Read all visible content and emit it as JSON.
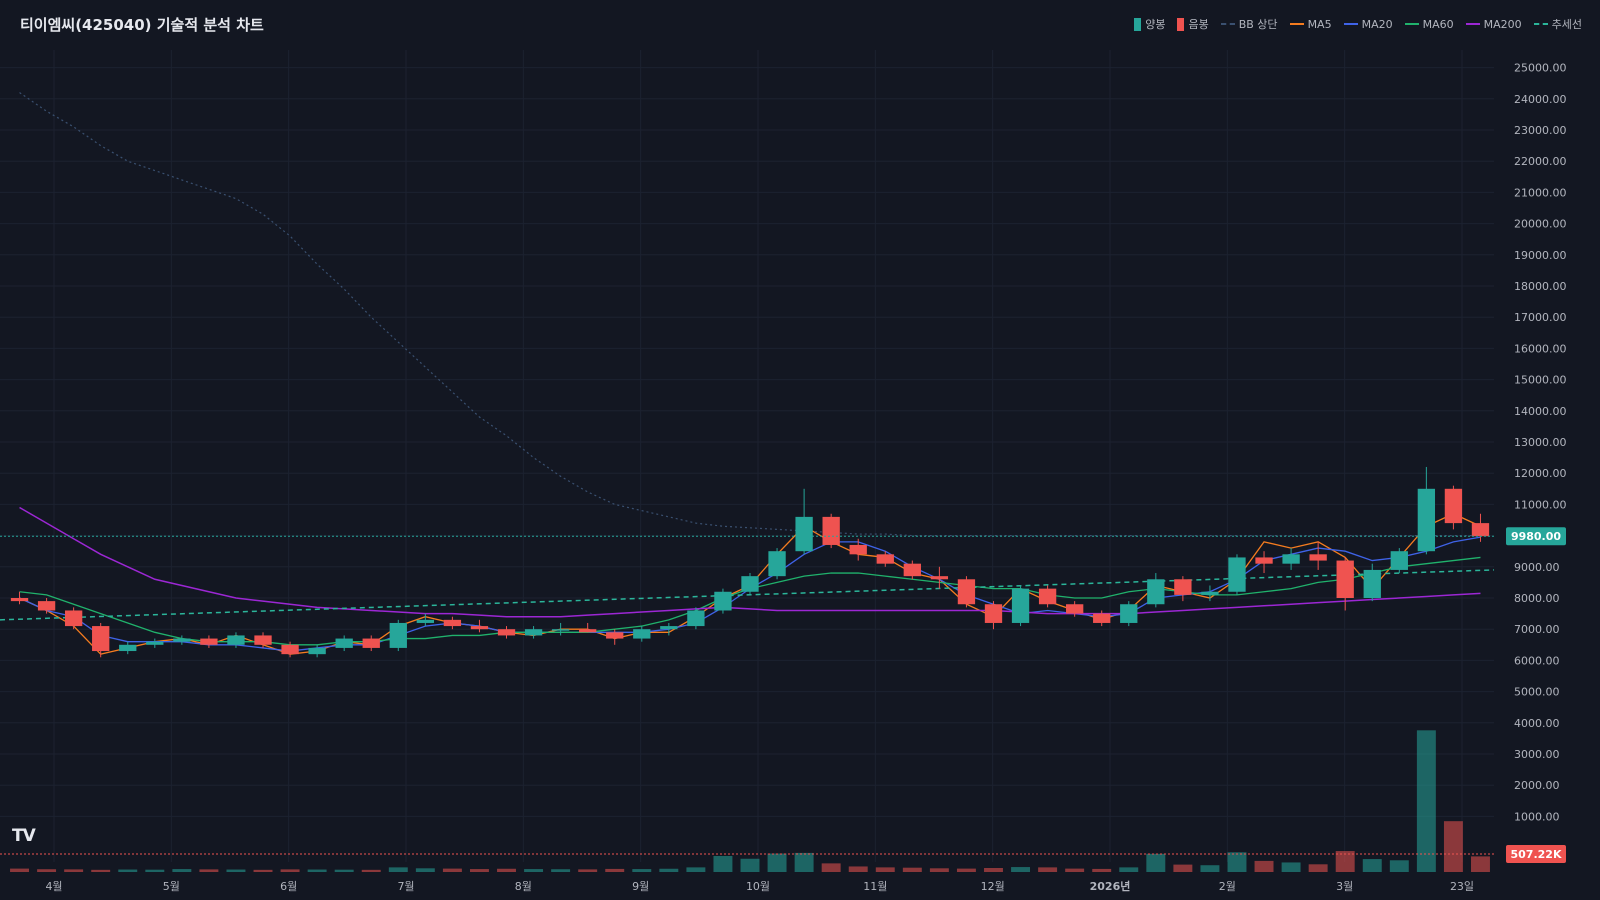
{
  "title": "티이엠씨(425040) 기술적 분석 차트",
  "logo_text": "TV",
  "colors": {
    "background": "#131722",
    "grid": "#1c2230",
    "up": "#26a69a",
    "down": "#ef5350",
    "bb_upper": "#3a5070",
    "ma5": "#f57c1f",
    "ma20": "#3f63e8",
    "ma60": "#20b26c",
    "ma200": "#9c27d4",
    "trend": "#2bb59a",
    "axis_text": "#b2b5be"
  },
  "legend": [
    {
      "label": "양봉",
      "kind": "box",
      "color": "#26a69a"
    },
    {
      "label": "음봉",
      "kind": "box",
      "color": "#ef5350"
    },
    {
      "label": "BB 상단",
      "kind": "dash",
      "color": "#3a5070"
    },
    {
      "label": "MA5",
      "kind": "line",
      "color": "#f57c1f"
    },
    {
      "label": "MA20",
      "kind": "line",
      "color": "#3f63e8"
    },
    {
      "label": "MA60",
      "kind": "line",
      "color": "#20b26c"
    },
    {
      "label": "MA200",
      "kind": "line",
      "color": "#9c27d4"
    },
    {
      "label": "추세선",
      "kind": "dash",
      "color": "#2bb59a"
    }
  ],
  "chart_data": {
    "type": "candlestick",
    "title": "티이엠씨(425040) 기술적 분석 차트",
    "y_axis": {
      "ticks": [
        "25000.00",
        "24000.00",
        "23000.00",
        "22000.00",
        "21000.00",
        "20000.00",
        "19000.00",
        "18000.00",
        "17000.00",
        "16000.00",
        "15000.00",
        "14000.00",
        "13000.00",
        "12000.00",
        "11000.00",
        "10000.00",
        "9000.00",
        "8000.00",
        "7000.00",
        "6000.00",
        "5000.00",
        "4000.00",
        "3000.00",
        "2000.00",
        "1000.00"
      ],
      "range": [
        0,
        25500
      ]
    },
    "x_axis": {
      "labels": [
        "4월",
        "5월",
        "6월",
        "7월",
        "8월",
        "9월",
        "10월",
        "11월",
        "12월",
        "2026년",
        "2월",
        "3월",
        "23일"
      ]
    },
    "current_price": {
      "label": "9980.00",
      "value": 9980
    },
    "current_volume": {
      "label": "507.22K"
    },
    "series": [
      {
        "name": "MA5",
        "values": [
          8000,
          7600,
          7100,
          6200,
          6400,
          6600,
          6700,
          6500,
          6800,
          6500,
          6200,
          6300,
          6600,
          6500,
          7100,
          7400,
          7200,
          7100,
          6900,
          6800,
          7000,
          7000,
          6700,
          6900,
          6900,
          7400,
          8000,
          8400,
          9400,
          10300,
          9800,
          9400,
          9300,
          8800,
          8600,
          7800,
          7400,
          8300,
          7900,
          7600,
          7300,
          7600,
          8400,
          8200,
          8000,
          8600,
          9800,
          9600,
          9800,
          9300,
          8300,
          9300,
          10300,
          10700,
          10300
        ]
      },
      {
        "name": "MA20",
        "values": [
          8000,
          7600,
          7400,
          6800,
          6600,
          6600,
          6600,
          6500,
          6500,
          6400,
          6300,
          6400,
          6500,
          6500,
          6800,
          7100,
          7200,
          7100,
          6900,
          6900,
          6900,
          6900,
          6900,
          6900,
          7000,
          7200,
          7700,
          8300,
          8800,
          9400,
          9800,
          9800,
          9500,
          9000,
          8600,
          8100,
          7800,
          7500,
          7600,
          7500,
          7400,
          7500,
          8000,
          8100,
          8200,
          8600,
          9200,
          9400,
          9600,
          9500,
          9200,
          9300,
          9500,
          9800,
          9950
        ]
      },
      {
        "name": "MA60",
        "values": [
          8200,
          8100,
          7800,
          7500,
          7200,
          6900,
          6700,
          6600,
          6600,
          6600,
          6500,
          6500,
          6600,
          6600,
          6700,
          6700,
          6800,
          6800,
          6900,
          6900,
          6900,
          6900,
          7000,
          7100,
          7300,
          7600,
          8000,
          8300,
          8500,
          8700,
          8800,
          8800,
          8700,
          8600,
          8500,
          8400,
          8300,
          8300,
          8100,
          8000,
          8000,
          8200,
          8300,
          8200,
          8100,
          8100,
          8200,
          8300,
          8500,
          8600,
          8800,
          9000,
          9100,
          9200,
          9300
        ]
      },
      {
        "name": "MA200",
        "values": [
          10900,
          10400,
          9900,
          9400,
          9000,
          8600,
          8400,
          8200,
          8000,
          7900,
          7800,
          7700,
          7650,
          7600,
          7550,
          7500,
          7500,
          7450,
          7400,
          7400,
          7400,
          7450,
          7500,
          7550,
          7600,
          7650,
          7700,
          7650,
          7600,
          7600,
          7600,
          7600,
          7600,
          7600,
          7600,
          7600,
          7600,
          7550,
          7500,
          7500,
          7500,
          7500,
          7550,
          7600,
          7650,
          7700,
          7750,
          7800,
          7850,
          7900,
          7950,
          8000,
          8050,
          8100,
          8150
        ]
      },
      {
        "name": "BB 상단",
        "values": [
          24200,
          23600,
          23100,
          22500,
          22000,
          21700,
          21400,
          21100,
          20800,
          20300,
          19600,
          18700,
          17900,
          17000,
          16200,
          15400,
          14600,
          13800,
          13200,
          12500,
          11900,
          11400,
          11000,
          10800,
          10600,
          10400,
          10300,
          10250,
          10200,
          10150,
          10100,
          10050,
          10050,
          10000,
          10000,
          10000,
          10000,
          10000,
          10000,
          10000,
          10000,
          10000,
          10000,
          10000,
          10000,
          10000,
          10000,
          10000,
          10000,
          10000,
          10000,
          10000,
          10000,
          10000,
          10000
        ]
      },
      {
        "name": "추세선",
        "start": 7300,
        "end": 8900
      }
    ],
    "candles": [
      [
        8000,
        8200,
        7800,
        7900
      ],
      [
        7900,
        8000,
        7500,
        7600
      ],
      [
        7600,
        7700,
        7000,
        7100
      ],
      [
        7100,
        7200,
        6100,
        6300
      ],
      [
        6300,
        6600,
        6200,
        6500
      ],
      [
        6500,
        6700,
        6400,
        6600
      ],
      [
        6600,
        6800,
        6500,
        6700
      ],
      [
        6700,
        6800,
        6400,
        6500
      ],
      [
        6500,
        6900,
        6400,
        6800
      ],
      [
        6800,
        6900,
        6400,
        6500
      ],
      [
        6500,
        6600,
        6100,
        6200
      ],
      [
        6200,
        6500,
        6100,
        6400
      ],
      [
        6400,
        6800,
        6300,
        6700
      ],
      [
        6700,
        6800,
        6300,
        6400
      ],
      [
        6400,
        7300,
        6300,
        7200
      ],
      [
        7200,
        7500,
        7100,
        7300
      ],
      [
        7300,
        7400,
        7000,
        7100
      ],
      [
        7100,
        7300,
        6900,
        7000
      ],
      [
        7000,
        7100,
        6700,
        6800
      ],
      [
        6800,
        7100,
        6700,
        7000
      ],
      [
        7000,
        7200,
        6800,
        7000
      ],
      [
        7000,
        7200,
        6900,
        6900
      ],
      [
        6900,
        7000,
        6500,
        6700
      ],
      [
        6700,
        7100,
        6600,
        7000
      ],
      [
        7000,
        7200,
        6800,
        7100
      ],
      [
        7100,
        7700,
        7000,
        7600
      ],
      [
        7600,
        8300,
        7500,
        8200
      ],
      [
        8200,
        8800,
        8100,
        8700
      ],
      [
        8700,
        9600,
        8600,
        9500
      ],
      [
        9500,
        11500,
        9400,
        10600
      ],
      [
        10600,
        10700,
        9600,
        9700
      ],
      [
        9700,
        9900,
        9200,
        9400
      ],
      [
        9400,
        9500,
        9000,
        9100
      ],
      [
        9100,
        9200,
        8600,
        8700
      ],
      [
        8700,
        9000,
        8300,
        8600
      ],
      [
        8600,
        8700,
        7700,
        7800
      ],
      [
        7800,
        7900,
        7000,
        7200
      ],
      [
        7200,
        8400,
        7100,
        8300
      ],
      [
        8300,
        8400,
        7700,
        7800
      ],
      [
        7800,
        7900,
        7400,
        7500
      ],
      [
        7500,
        7600,
        7100,
        7200
      ],
      [
        7200,
        7900,
        7100,
        7800
      ],
      [
        7800,
        8800,
        7700,
        8600
      ],
      [
        8600,
        8700,
        7900,
        8100
      ],
      [
        8100,
        8400,
        7900,
        8200
      ],
      [
        8200,
        9400,
        8100,
        9300
      ],
      [
        9300,
        9500,
        8800,
        9100
      ],
      [
        9100,
        9600,
        8900,
        9400
      ],
      [
        9400,
        9800,
        8900,
        9200
      ],
      [
        9200,
        9300,
        7600,
        8000
      ],
      [
        8000,
        9100,
        7900,
        8900
      ],
      [
        8900,
        9600,
        8800,
        9500
      ],
      [
        9500,
        12200,
        9400,
        11500
      ],
      [
        11500,
        11600,
        10200,
        10400
      ],
      [
        10400,
        10700,
        9800,
        9980
      ]
    ],
    "volume": {
      "ticks": [
        "4000.00",
        "3000.00",
        "2000.00",
        "1000.00"
      ],
      "values": [
        110,
        90,
        85,
        70,
        80,
        75,
        95,
        85,
        80,
        70,
        85,
        80,
        75,
        70,
        150,
        120,
        110,
        95,
        105,
        95,
        90,
        85,
        100,
        95,
        105,
        150,
        520,
        430,
        600,
        620,
        280,
        180,
        150,
        140,
        120,
        110,
        130,
        160,
        150,
        110,
        100,
        150,
        590,
        240,
        220,
        640,
        360,
        310,
        250,
        680,
        420,
        380,
        4600,
        1650,
        507
      ]
    }
  }
}
